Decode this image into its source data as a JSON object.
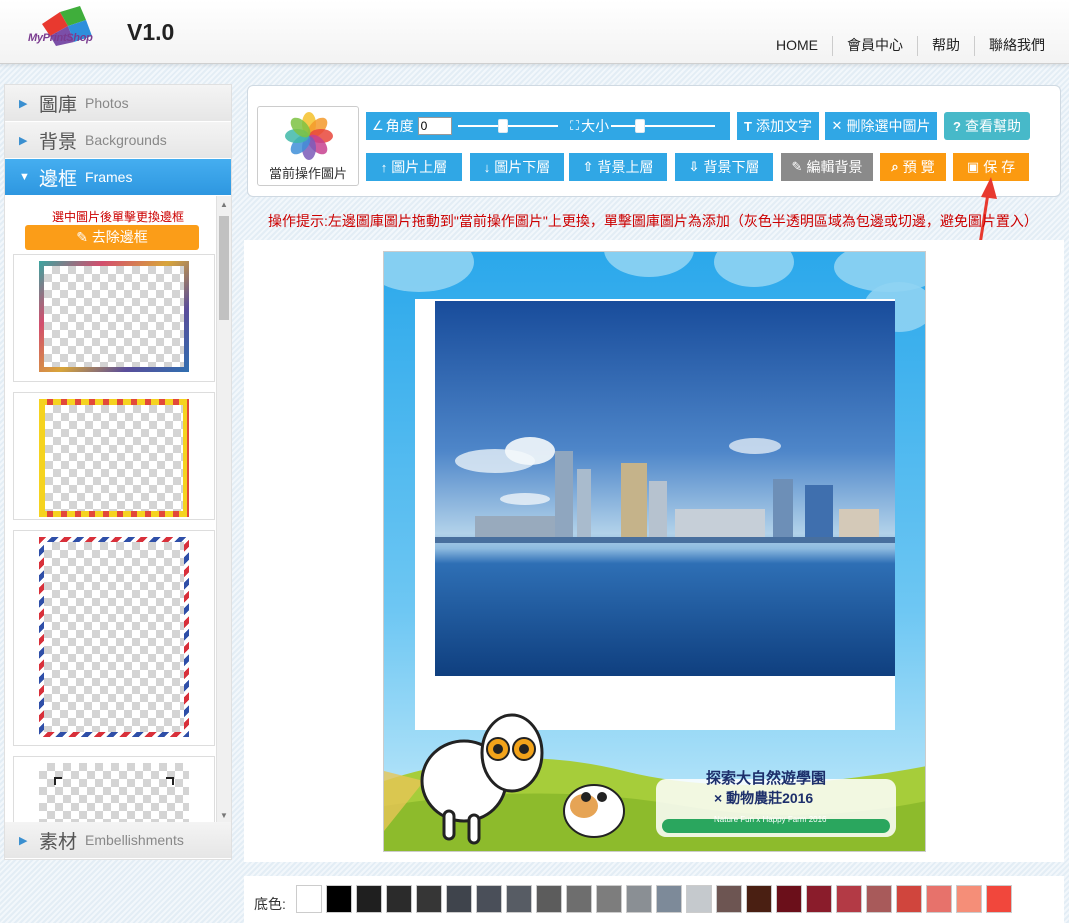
{
  "header": {
    "logo_text": "MyPrintShop",
    "version": "V1.0",
    "nav": [
      "HOME",
      "會員中心",
      "帮助",
      "聯絡我們"
    ]
  },
  "sidebar": {
    "sections": [
      {
        "cn": "圖庫",
        "en": "Photos"
      },
      {
        "cn": "背景",
        "en": "Backgrounds"
      },
      {
        "cn": "邊框",
        "en": "Frames",
        "active": true
      }
    ],
    "last_section": {
      "cn": "素材",
      "en": "Embellishments"
    },
    "frames_hint": "選中圖片後單擊更換邊框",
    "remove_frame": "去除邊框"
  },
  "toolbar": {
    "current_image_label": "當前操作圖片",
    "angle_label": "角度",
    "angle_value": "0",
    "size_label": "大小",
    "add_text": "添加文字",
    "delete_selected": "刪除選中圖片",
    "help": "查看幫助",
    "image_up": "圖片上層",
    "image_down": "圖片下層",
    "bg_up": "背景上層",
    "bg_down": "背景下層",
    "edit_bg": "編輯背景",
    "preview": "預 覽",
    "save": "保 存"
  },
  "tip": "操作提示:左邊圖庫圖片拖動到\"當前操作圖片\"上更換，單擊圖庫圖片為添加（灰色半透明區域為包邊或切邊，避免圖片置入）",
  "design": {
    "logo_line1": "探索大自然遊學園",
    "logo_line2": "× 動物農莊2016",
    "logo_line3": "Nature Fun x Happy Farm 2016"
  },
  "color_bar": {
    "label": "底色:",
    "swatches": [
      "#ffffff",
      "#000000",
      "#1f1f1f",
      "#2b2b2b",
      "#363636",
      "#3f444c",
      "#4a4f59",
      "#575c64",
      "#5c5c5c",
      "#6e6e6e",
      "#7d7d7d",
      "#8a8f94",
      "#7d8a99",
      "#c5c9cd",
      "#6d5552",
      "#4a1f12",
      "#6b0f1a",
      "#8a1c2b",
      "#b33a45",
      "#a85a5a",
      "#d0453d",
      "#e7726b",
      "#f58e78",
      "#f1473c"
    ]
  }
}
